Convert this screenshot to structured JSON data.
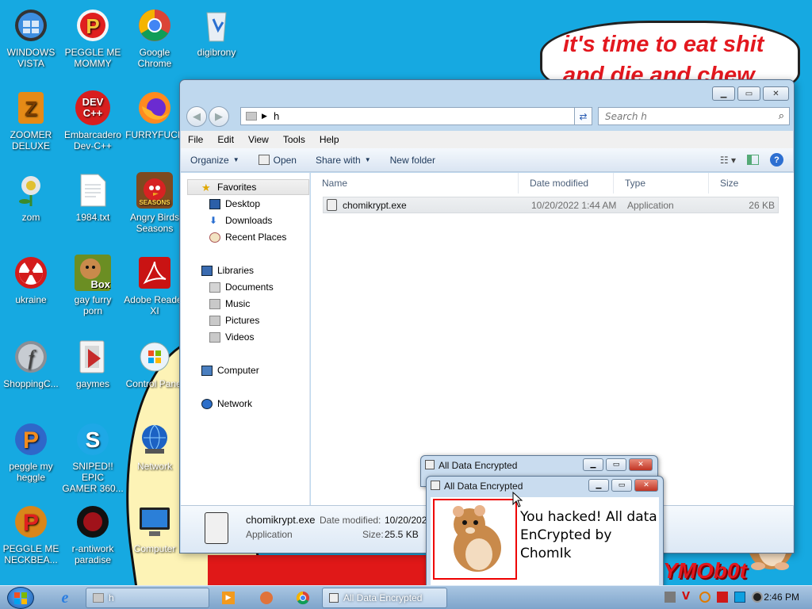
{
  "desktop": {
    "speech_text": "it's time to eat shit and die and chew",
    "corner_text": "YMOb0t",
    "icons": [
      {
        "label": "WINDOWS\nVISTA"
      },
      {
        "label": "PEGGLE ME\nMOMMY"
      },
      {
        "label": "Google\nChrome"
      },
      {
        "label": "digibrony"
      },
      {
        "label": "ZOOMER\nDELUXE"
      },
      {
        "label": "Embarcadero\nDev-C++"
      },
      {
        "label": "FURRYFUCK"
      },
      {
        "label": "zom"
      },
      {
        "label": "1984.txt"
      },
      {
        "label": "Angry Birds\nSeasons"
      },
      {
        "label": "ukraine"
      },
      {
        "label": "gay furry\nporn"
      },
      {
        "label": "Adobe Reader\nXI"
      },
      {
        "label": "ShoppingC..."
      },
      {
        "label": "gaymes"
      },
      {
        "label": "Control Panel"
      },
      {
        "label": "peggle my\nheggle"
      },
      {
        "label": "SNIPED!! EPIC\nGAMER 360..."
      },
      {
        "label": "Network"
      },
      {
        "label": "PEGGLE ME\nNECKBEA..."
      },
      {
        "label": "r-antiwork\nparadise"
      },
      {
        "label": "Computer"
      }
    ],
    "icon_badges": {
      "devcpp": "DEV\nC++",
      "box": "Box",
      "seasons": "SEASONS"
    }
  },
  "explorer": {
    "address_path": "h",
    "search_placeholder": "Search h",
    "menu": [
      "File",
      "Edit",
      "View",
      "Tools",
      "Help"
    ],
    "toolbar": {
      "organize": "Organize",
      "open": "Open",
      "share_with": "Share with",
      "new_folder": "New folder",
      "help": "?"
    },
    "nav": {
      "favorites": "Favorites",
      "desktop": "Desktop",
      "downloads": "Downloads",
      "recent_places": "Recent Places",
      "libraries": "Libraries",
      "documents": "Documents",
      "music": "Music",
      "pictures": "Pictures",
      "videos": "Videos",
      "computer": "Computer",
      "network": "Network"
    },
    "columns": {
      "name": "Name",
      "date_modified": "Date modified",
      "type": "Type",
      "size": "Size"
    },
    "files": [
      {
        "name": "chomikrypt.exe",
        "date_modified": "10/20/2022 1:44 AM",
        "type": "Application",
        "size": "26 KB"
      }
    ],
    "details": {
      "filename": "chomikrypt.exe",
      "type": "Application",
      "date_label": "Date modified:",
      "date_value": "10/20/2022",
      "size_label": "Size:",
      "size_value": "25.5 KB"
    }
  },
  "dialogs": {
    "back_title": "All Data Encrypted",
    "front_title": "All Data Encrypted",
    "message": "You hacked! All data\nEnCrypted by ChomIk"
  },
  "taskbar": {
    "explorer_button": "h",
    "dialog_button": "All Data Encrypted",
    "clock": "2:46 PM"
  },
  "colors": {
    "desktop_bg": "#16a9e1",
    "speech_text": "#e3181f",
    "dialog_close": "#c13524",
    "file_icon_accent": "#e3181f"
  }
}
